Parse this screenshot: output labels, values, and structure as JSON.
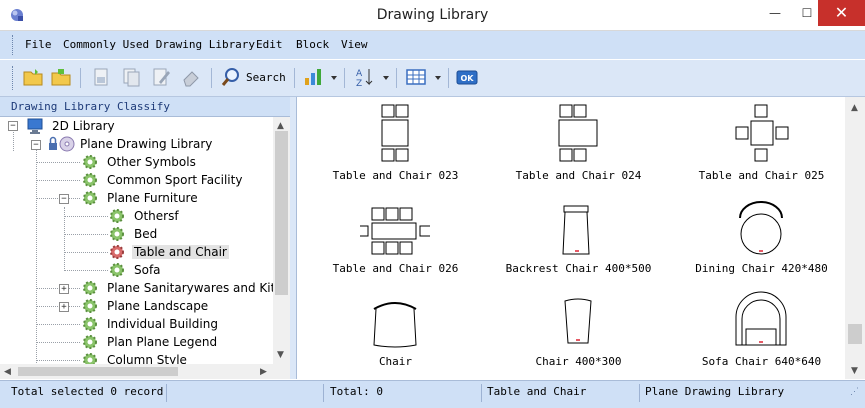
{
  "window": {
    "title": "Drawing Library",
    "minimize": "—",
    "maximize": "☐",
    "close": "✕"
  },
  "menu": {
    "items": [
      "File",
      "Commonly Used Drawing Library",
      "Edit",
      "Block",
      "View"
    ]
  },
  "toolbar": {
    "search_label": "Search",
    "ok_label": "OK"
  },
  "left_panel": {
    "header": "Drawing Library Classify",
    "tree": [
      {
        "label": "2D Library",
        "expander": "−"
      },
      {
        "label": "Plane Drawing Library",
        "expander": "−"
      },
      {
        "label": "Other Symbols"
      },
      {
        "label": "Common Sport Facility"
      },
      {
        "label": "Plane Furniture",
        "expander": "−"
      },
      {
        "label": "Othersf"
      },
      {
        "label": "Bed"
      },
      {
        "label": "Table and Chair",
        "selected": true
      },
      {
        "label": "Sofa"
      },
      {
        "label": "Plane Sanitarywares and Kitche",
        "expander": "+"
      },
      {
        "label": "Plane Landscape",
        "expander": "+"
      },
      {
        "label": "Individual Building"
      },
      {
        "label": "Plan Plane Legend"
      },
      {
        "label": "Column Style"
      }
    ]
  },
  "items": [
    {
      "label": "Table and Chair 023",
      "icon": "table-chair-023-icon"
    },
    {
      "label": "Table and Chair 024",
      "icon": "table-chair-024-icon"
    },
    {
      "label": "Table and Chair 025",
      "icon": "table-chair-025-icon"
    },
    {
      "label": "Table and Chair 026",
      "icon": "table-chair-026-icon"
    },
    {
      "label": "Backrest Chair 400*500",
      "icon": "backrest-chair-icon"
    },
    {
      "label": "Dining Chair 420*480",
      "icon": "dining-chair-icon"
    },
    {
      "label": "Chair",
      "icon": "chair-icon"
    },
    {
      "label": "Chair 400*300",
      "icon": "chair-400-300-icon"
    },
    {
      "label": "Sofa Chair 640*640",
      "icon": "sofa-chair-icon"
    }
  ],
  "status": {
    "selected": "Total selected 0 record",
    "total": "Total: 0",
    "category": "Table and Chair",
    "library": "Plane Drawing Library"
  },
  "colors": {
    "chrome": "#cfe0f6",
    "toolbar": "#dbe7f7",
    "close": "#c7302b"
  }
}
